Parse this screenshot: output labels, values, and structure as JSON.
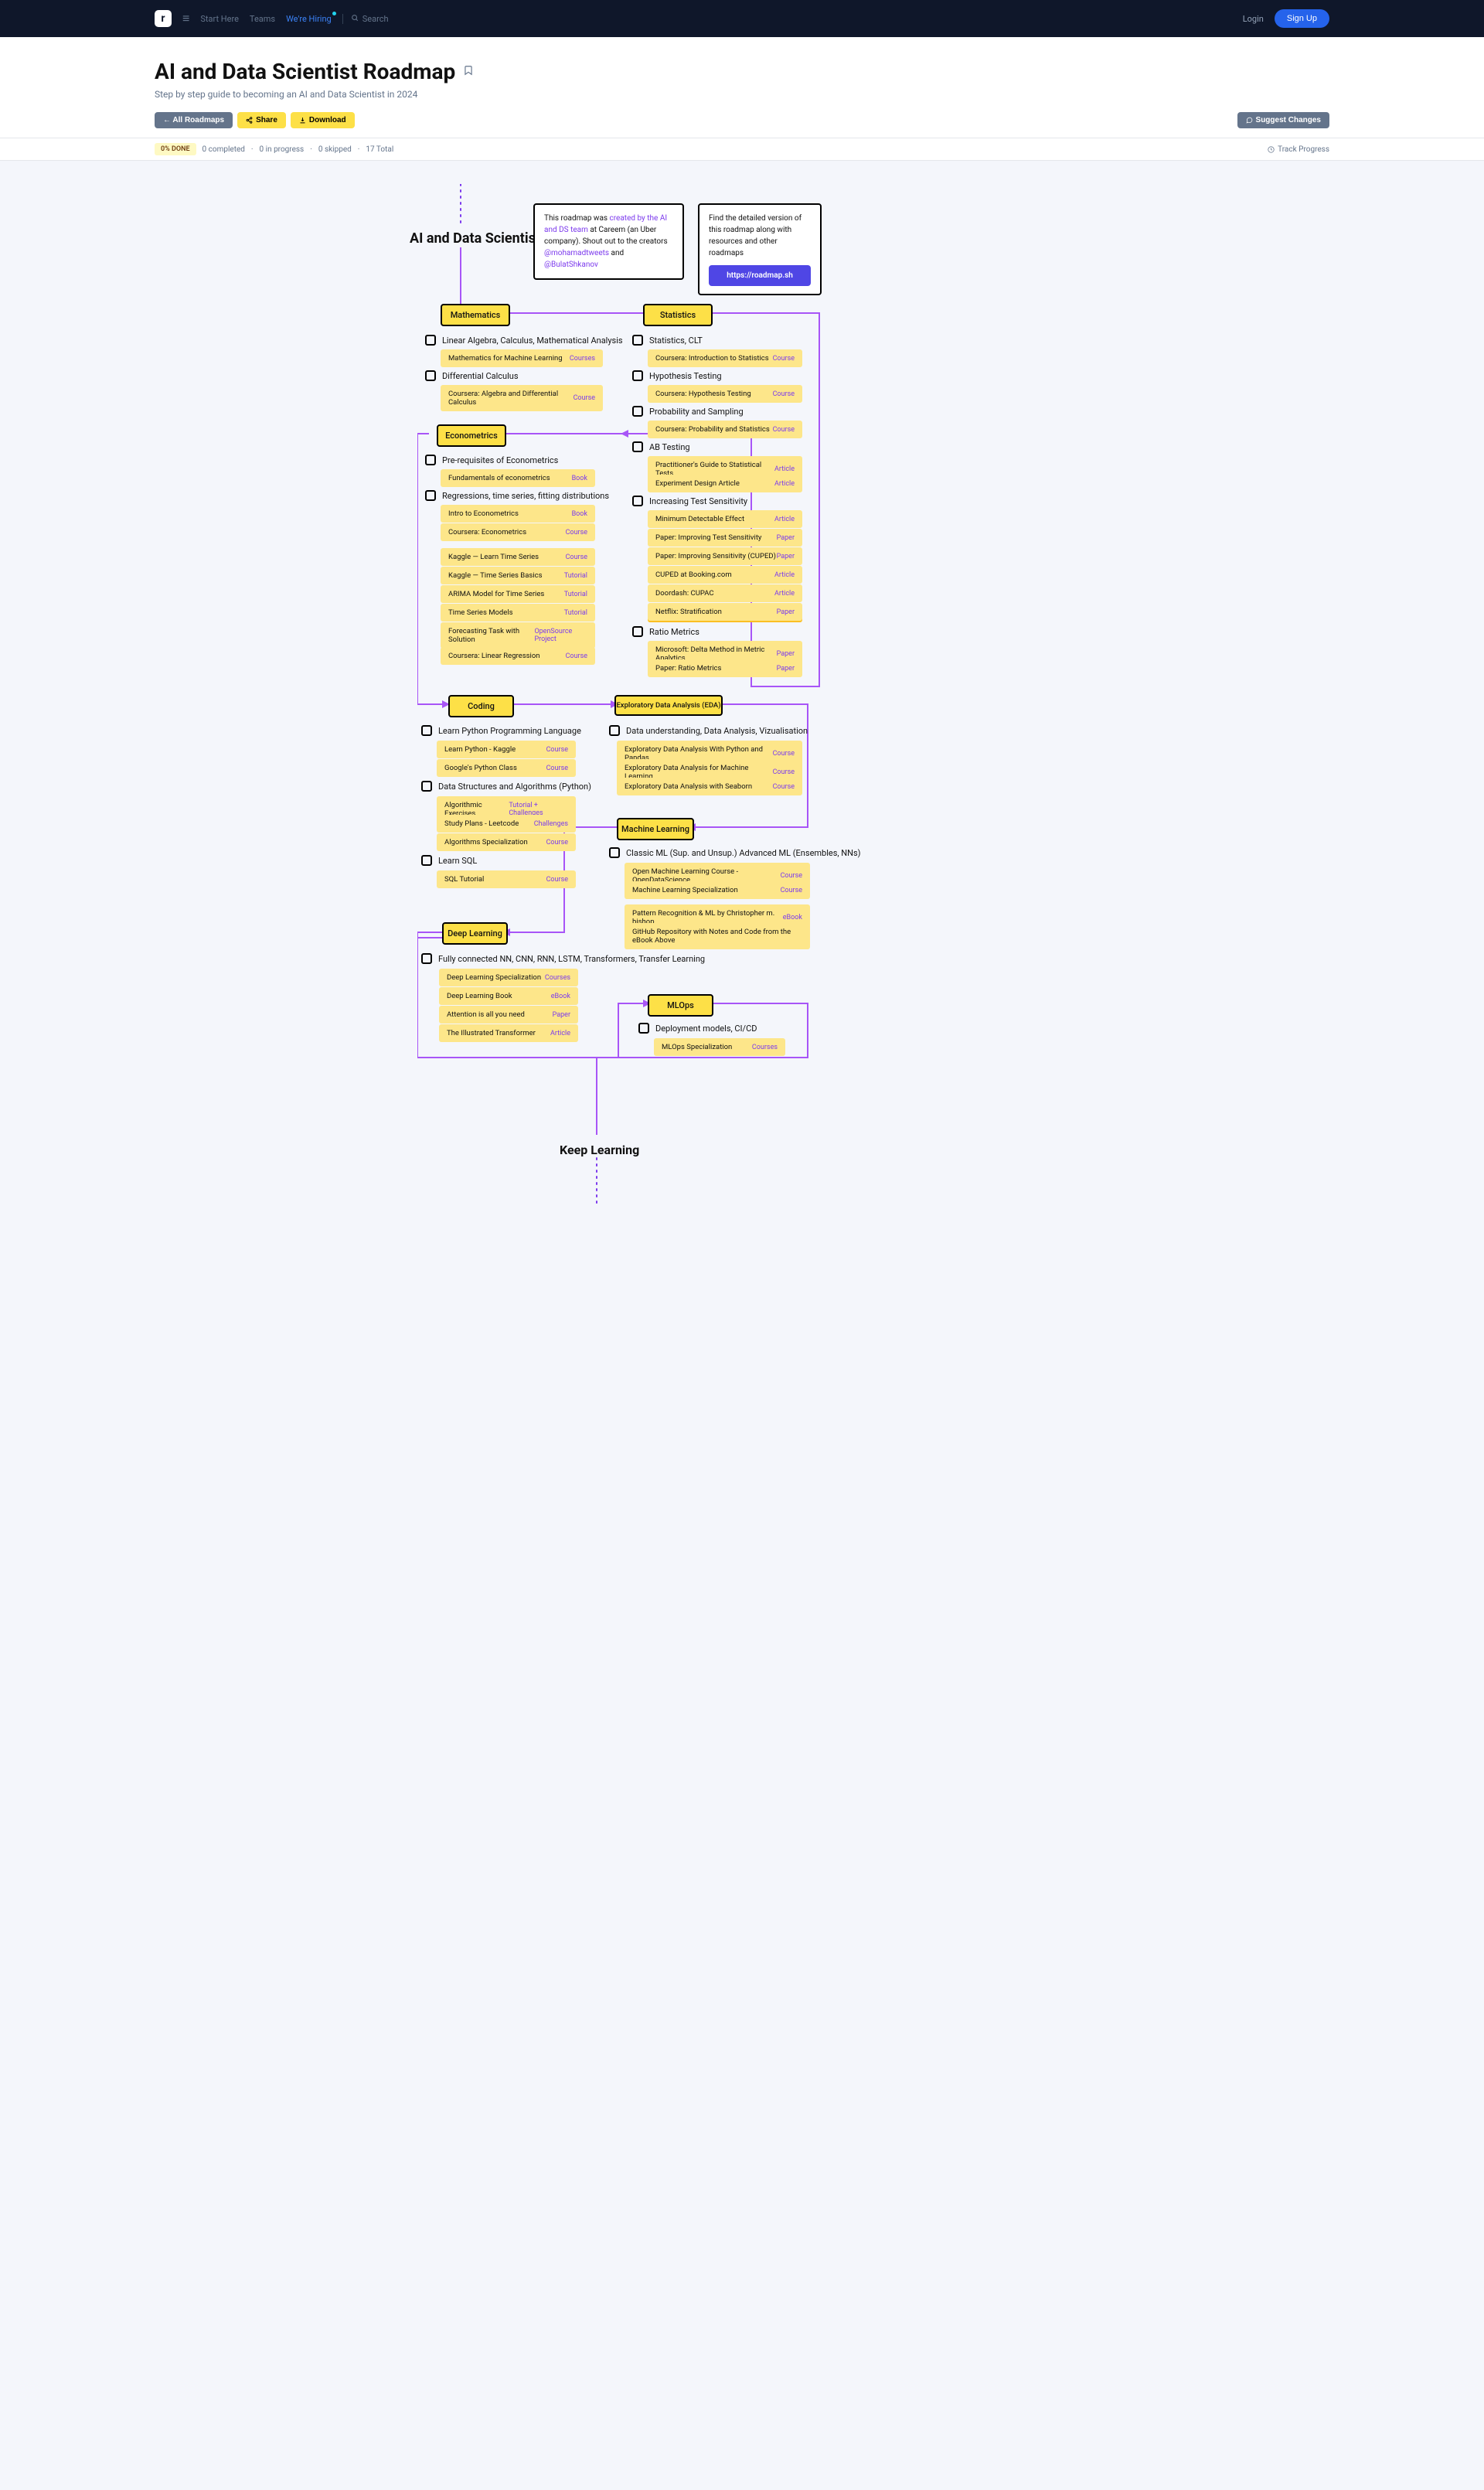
{
  "header": {
    "nav": {
      "start": "Start Here",
      "teams": "Teams",
      "hiring": "We're Hiring",
      "search": "Search"
    },
    "login": "Login",
    "signup": "Sign Up"
  },
  "title": "AI and Data Scientist Roadmap",
  "subtitle": "Step by step guide to becoming an AI and Data Scientist in 2024",
  "toolbar": {
    "all": "← All Roadmaps",
    "share": "Share",
    "download": "Download",
    "suggest": "Suggest Changes"
  },
  "progress": {
    "done": "0% DONE",
    "completed": "0 completed",
    "inprogress": "0 in progress",
    "skipped": "0 skipped",
    "total": "17 Total",
    "track": "Track Progress"
  },
  "root": "AI and Data Scientist",
  "info1": {
    "prefix": "This roadmap was ",
    "link1": "created by the AI and DS team",
    "mid": " at Careem (an Uber company). Shout out to the creators ",
    "h1": "@mohamadtweets",
    "and": " and ",
    "h2": "@BulatShkanov"
  },
  "info2": {
    "text": "Find the detailed version of this roadmap along with resources and other roadmaps",
    "btn": "https://roadmap.sh"
  },
  "keep": "Keep Learning",
  "nodes": {
    "math": "Mathematics",
    "stats": "Statistics",
    "econ": "Econometrics",
    "coding": "Coding",
    "eda": "Exploratory Data Analysis (EDA)",
    "ml": "Machine Learning",
    "dl": "Deep Learning",
    "mlops": "MLOps"
  },
  "sub": {
    "linalg": "Linear Algebra, Calculus, Mathematical Analysis",
    "diffcalc": "Differential Calculus",
    "statsclt": "Statistics, CLT",
    "hyp": "Hypothesis Testing",
    "prob": "Probability and Sampling",
    "ab": "AB Testing",
    "its": "Increasing Test Sensitivity",
    "ratio": "Ratio Metrics",
    "preecon": "Pre-requisites of Econometrics",
    "reg": "Regressions, time series, fitting distributions",
    "python": "Learn Python Programming Language",
    "dsa": "Data Structures and Algorithms (Python)",
    "sql": "Learn SQL",
    "edasub": "Data understanding, Data Analysis, Vizualisation",
    "classicml": "Classic ML (Sup. and Unsup.) Advanced ML (Ensembles, NNs)",
    "dlsub": "Fully connected NN, CNN, RNN, LSTM, Transformers, Transfer Learning",
    "deploy": "Deployment models, CI/CD"
  },
  "res": {
    "mathml": {
      "t": "Mathematics for Machine Learning",
      "k": "Courses"
    },
    "algcalc": {
      "t": "Coursera: Algebra and Differential Calculus",
      "k": "Course"
    },
    "introstats": {
      "t": "Coursera: Introduction to Statistics",
      "k": "Course"
    },
    "hyptest": {
      "t": "Coursera: Hypothesis Testing",
      "k": "Course"
    },
    "probstats": {
      "t": "Coursera: Probability and Statistics",
      "k": "Course"
    },
    "practguide": {
      "t": "Practitioner's Guide to Statistical Tests",
      "k": "Article"
    },
    "expdesign": {
      "t": "Experiment Design Article",
      "k": "Article"
    },
    "mde": {
      "t": "Minimum Detectable Effect",
      "k": "Article"
    },
    "improvets": {
      "t": "Paper: Improving Test Sensitivity",
      "k": "Paper"
    },
    "cuped": {
      "t": "Paper: Improving Sensitivity (CUPED)",
      "k": "Paper"
    },
    "booking": {
      "t": "CUPED at Booking.com",
      "k": "Article"
    },
    "doordash": {
      "t": "Doordash: CUPAC",
      "k": "Article"
    },
    "netflix": {
      "t": "Netflix: Stratification",
      "k": "Paper"
    },
    "delta": {
      "t": "Microsoft: Delta Method in Metric Analytics",
      "k": "Paper"
    },
    "ratiop": {
      "t": "Paper: Ratio Metrics",
      "k": "Paper"
    },
    "fundecon": {
      "t": "Fundamentals of econometrics",
      "k": "Book"
    },
    "introecon": {
      "t": "Intro to Econometrics",
      "k": "Book"
    },
    "coursecon": {
      "t": "Coursera: Econometrics",
      "k": "Course"
    },
    "kagglets": {
      "t": "Kaggle — Learn Time Series",
      "k": "Course"
    },
    "kagglets2": {
      "t": "Kaggle — Time Series Basics",
      "k": "Tutorial"
    },
    "arima": {
      "t": "ARIMA Model for Time Series",
      "k": "Tutorial"
    },
    "tsmodels": {
      "t": "Time Series Models",
      "k": "Tutorial"
    },
    "forecast": {
      "t": "Forecasting Task with Solution",
      "k": "OpenSource Project"
    },
    "linreg": {
      "t": "Coursera: Linear Regression",
      "k": "Course"
    },
    "kagglepy": {
      "t": "Learn Python - Kaggle",
      "k": "Course"
    },
    "googlepy": {
      "t": "Google's Python Class",
      "k": "Course"
    },
    "algoex": {
      "t": "Algorithmic Exercises",
      "k": "Tutorial + Challenges"
    },
    "leetcode": {
      "t": "Study Plans - Leetcode",
      "k": "Challenges"
    },
    "algospec": {
      "t": "Algorithms Specialization",
      "k": "Course"
    },
    "sqltut": {
      "t": "SQL Tutorial",
      "k": "Course"
    },
    "edapd": {
      "t": "Exploratory Data Analysis With Python and Pandas",
      "k": "Course"
    },
    "edaml": {
      "t": "Exploratory Data Analysis for Machine Learning",
      "k": "Course"
    },
    "seaborn": {
      "t": "Exploratory Data Analysis with Seaborn",
      "k": "Course"
    },
    "openml": {
      "t": "Open Machine Learning Course - OpenDataScience",
      "k": "Course"
    },
    "mlspec": {
      "t": "Machine Learning Specialization",
      "k": "Course"
    },
    "bishop": {
      "t": "Pattern Recognition & ML by Christopher m. bishop",
      "k": "eBook"
    },
    "github": {
      "t": "GitHub Repository with Notes and Code from the eBook Above",
      "k": ""
    },
    "dlspec": {
      "t": "Deep Learning Specialization",
      "k": "Courses"
    },
    "dlbook": {
      "t": "Deep Learning Book",
      "k": "eBook"
    },
    "attention": {
      "t": "Attention is all you need",
      "k": "Paper"
    },
    "illustrans": {
      "t": "The Illustrated Transformer",
      "k": "Article"
    },
    "mlopsspec": {
      "t": "MLOps Specialization",
      "k": "Courses"
    }
  }
}
